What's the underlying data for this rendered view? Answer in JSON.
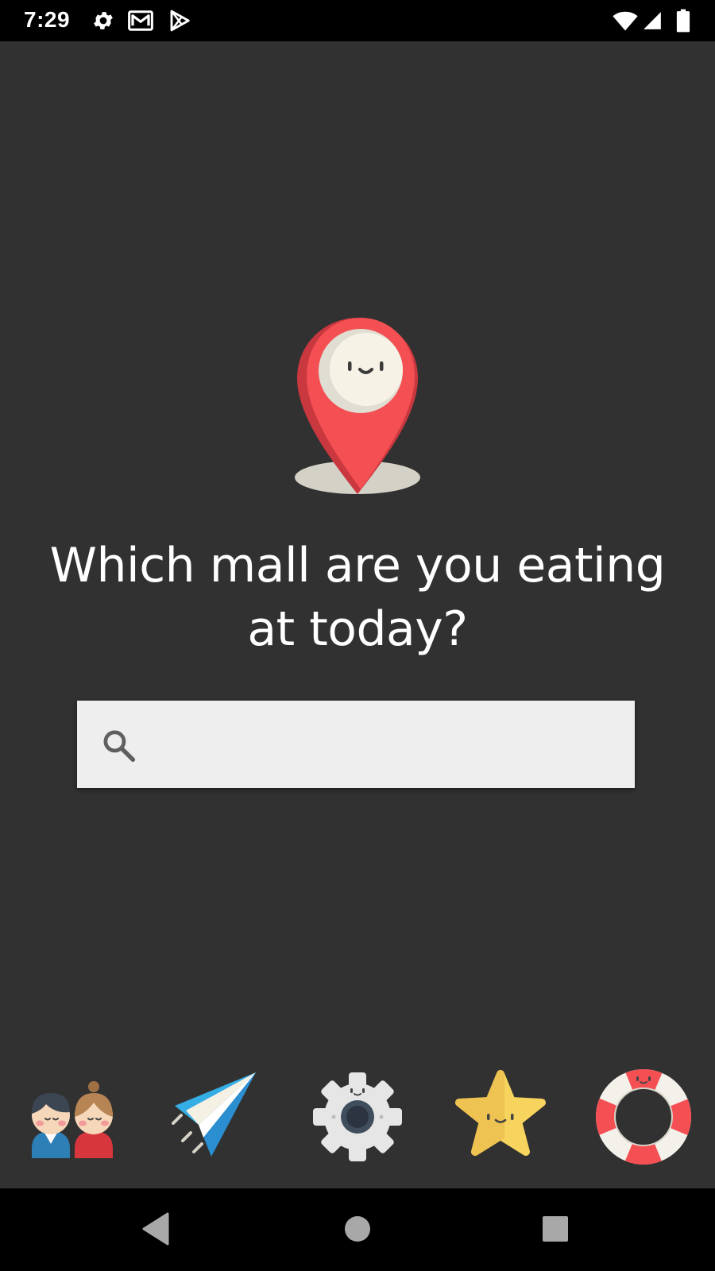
{
  "status_bar": {
    "time": "7:29",
    "left_icons": [
      "gear-icon",
      "gmail-icon",
      "play-store-icon"
    ],
    "right_icons": [
      "wifi-icon",
      "signal-icon",
      "battery-icon"
    ]
  },
  "main": {
    "hero_icon": "location-pin-icon",
    "headline": "Which mall are you eating at today?",
    "search": {
      "placeholder": "",
      "value": "",
      "icon": "search-icon"
    }
  },
  "bottom_icons": [
    {
      "name": "people-icon"
    },
    {
      "name": "paper-plane-icon"
    },
    {
      "name": "settings-gear-icon"
    },
    {
      "name": "star-icon"
    },
    {
      "name": "lifebuoy-icon"
    }
  ],
  "nav_bar": {
    "buttons": [
      "back-button",
      "home-button",
      "recents-button"
    ]
  },
  "colors": {
    "background": "#313131",
    "bars": "#000000",
    "pin_red": "#f44f53",
    "search_bg": "#eeeeee"
  }
}
